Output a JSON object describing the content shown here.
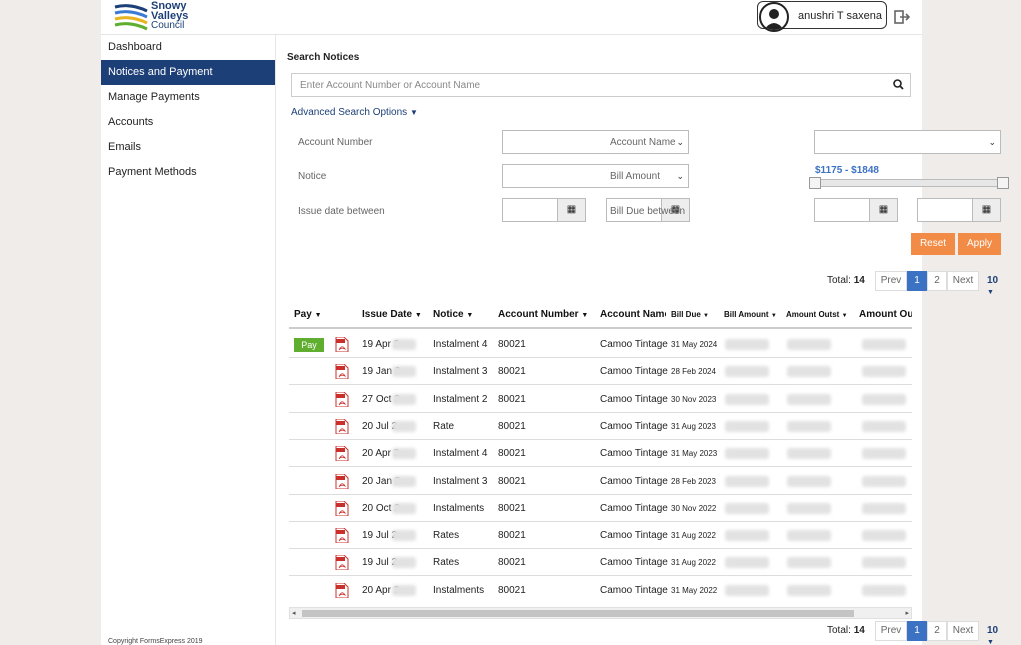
{
  "brand": {
    "line1": "Snowy",
    "line2": "Valleys",
    "line3": "Council",
    "colors": [
      "#1d3f77",
      "#3a7bd5",
      "#e8b521",
      "#5fae2f"
    ]
  },
  "user": {
    "name": "anushri T saxena"
  },
  "sidebar": {
    "items": [
      {
        "label": "Dashboard"
      },
      {
        "label": "Notices and Payment",
        "active": true
      },
      {
        "label": "Manage Payments"
      },
      {
        "label": "Accounts"
      },
      {
        "label": "Emails"
      },
      {
        "label": "Payment Methods"
      }
    ],
    "copyright": "Copyright FormsExpress 2019"
  },
  "search": {
    "title": "Search Notices",
    "placeholder": "Enter Account Number or Account Name",
    "advanced_label": "Advanced Search Options"
  },
  "filters": {
    "account_number_label": "Account Number",
    "account_name_label": "Account Name",
    "notice_label": "Notice",
    "bill_amount_label": "Bill Amount",
    "bill_amount_range": "$1175 - $1848",
    "issue_date_label": "Issue date between",
    "bill_due_label": "Bill Due between",
    "reset_label": "Reset",
    "apply_label": "Apply"
  },
  "pagination": {
    "total_label": "Total:",
    "total": "14",
    "prev": "Prev",
    "pages": [
      "1",
      "2"
    ],
    "next": "Next",
    "per_page": "10"
  },
  "table": {
    "columns": [
      "Pay",
      "Issue Date",
      "Notice",
      "Account Number",
      "Account Name",
      "Bill Due",
      "Bill Amount",
      "Amount Outst",
      "Amount Ou"
    ],
    "pay_label": "Pay",
    "rows": [
      {
        "pay": true,
        "issue_date": "19 Apr 2",
        "notice": "Instalment 4",
        "account_number": "80021",
        "account_name": "Camoo Tintage",
        "bill_due": "31 May 2024"
      },
      {
        "pay": false,
        "issue_date": "19 Jan 2",
        "notice": "Instalment 3",
        "account_number": "80021",
        "account_name": "Camoo Tintage",
        "bill_due": "28 Feb 2024"
      },
      {
        "pay": false,
        "issue_date": "27 Oct 2",
        "notice": "Instalment 2",
        "account_number": "80021",
        "account_name": "Camoo Tintage",
        "bill_due": "30 Nov 2023"
      },
      {
        "pay": false,
        "issue_date": "20 Jul 2",
        "notice": "Rate",
        "account_number": "80021",
        "account_name": "Camoo Tintage",
        "bill_due": "31 Aug 2023"
      },
      {
        "pay": false,
        "issue_date": "20 Apr 2",
        "notice": "Instalment 4",
        "account_number": "80021",
        "account_name": "Camoo Tintage",
        "bill_due": "31 May 2023"
      },
      {
        "pay": false,
        "issue_date": "20 Jan 2",
        "notice": "Instalment 3",
        "account_number": "80021",
        "account_name": "Camoo Tintage",
        "bill_due": "28 Feb 2023"
      },
      {
        "pay": false,
        "issue_date": "20 Oct 2",
        "notice": "Instalments",
        "account_number": "80021",
        "account_name": "Camoo Tintage",
        "bill_due": "30 Nov 2022"
      },
      {
        "pay": false,
        "issue_date": "19 Jul 2",
        "notice": "Rates",
        "account_number": "80021",
        "account_name": "Camoo Tintage",
        "bill_due": "31 Aug 2022"
      },
      {
        "pay": false,
        "issue_date": "19 Jul 2",
        "notice": "Rates",
        "account_number": "80021",
        "account_name": "Camoo Tintage",
        "bill_due": "31 Aug 2022"
      },
      {
        "pay": false,
        "issue_date": "20 Apr 2",
        "notice": "Instalments",
        "account_number": "80021",
        "account_name": "Camoo Tintage",
        "bill_due": "31 May 2022"
      }
    ]
  }
}
